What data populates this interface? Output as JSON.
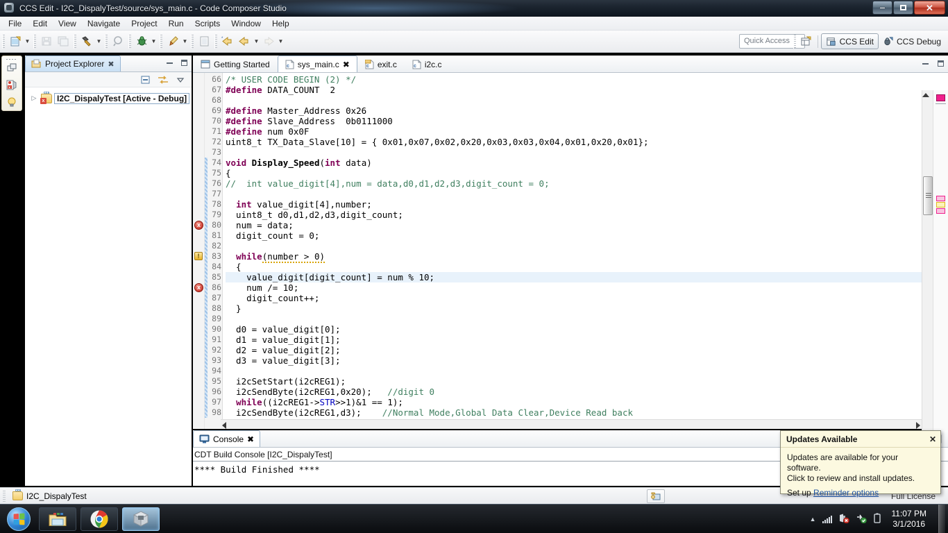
{
  "window": {
    "title": "CCS Edit - I2C_DispalyTest/source/sys_main.c - Code Composer Studio",
    "app_icon": "ccs-logo-icon",
    "minimize_label": "",
    "maximize_label": "",
    "close_label": "✕"
  },
  "menu": {
    "items": [
      {
        "label": "File"
      },
      {
        "label": "Edit"
      },
      {
        "label": "View"
      },
      {
        "label": "Navigate"
      },
      {
        "label": "Project"
      },
      {
        "label": "Run"
      },
      {
        "label": "Scripts"
      },
      {
        "label": "Window"
      },
      {
        "label": "Help"
      }
    ]
  },
  "toolbar": {
    "buttons": [
      {
        "name": "new-file-icon"
      },
      {
        "name": "save-icon"
      },
      {
        "name": "save-all-icon"
      },
      {
        "name": "build-hammer-icon"
      },
      {
        "name": "search-icon"
      },
      {
        "name": "debug-bug-icon"
      },
      {
        "name": "paintbrush-icon"
      },
      {
        "name": "open-declaration-icon"
      },
      {
        "name": "back-history-icon"
      },
      {
        "name": "back-arrow-icon"
      },
      {
        "name": "forward-arrow-icon"
      }
    ],
    "quick_access_placeholder": "Quick Access",
    "open-perspective-icon": "open-perspective-icon",
    "perspectives": [
      {
        "label": "CCS Edit",
        "selected": true,
        "icon": "ccs-edit-icon"
      },
      {
        "label": "CCS Debug",
        "selected": false,
        "icon": "ccs-debug-icon"
      }
    ]
  },
  "project_explorer": {
    "tab_label": "Project Explorer",
    "close_label": "✖",
    "minimize_label": "",
    "maximize_label": "",
    "toolbar_icons": [
      "collapse-all-icon",
      "link-with-editor-icon",
      "view-menu-icon"
    ],
    "tree": [
      {
        "label": "I2C_DispalyTest  [Active - Debug]",
        "twisty": "▷",
        "icon": "ccs-project-icon",
        "selected": true
      }
    ]
  },
  "editor": {
    "tabs": [
      {
        "label": "Getting Started",
        "icon": "getting-started-icon",
        "active": false,
        "closable": false
      },
      {
        "label": "sys_main.c",
        "icon": "c-file-icon",
        "active": true,
        "closable": true,
        "close_label": "✖"
      },
      {
        "label": "exit.c",
        "icon": "c-file-readonly-icon",
        "active": false,
        "closable": false
      },
      {
        "label": "i2c.c",
        "icon": "c-file-icon",
        "active": false,
        "closable": false
      }
    ],
    "minimize_label": "",
    "maximize_label": "",
    "first_line_number": 66,
    "lines": [
      {
        "n": 66,
        "text": "/* USER CODE BEGIN (2) */",
        "type": "comment"
      },
      {
        "n": 67,
        "text": "#define DATA_COUNT  2",
        "type": "preproc"
      },
      {
        "n": 68,
        "text": "",
        "type": "plain"
      },
      {
        "n": 69,
        "text": "#define Master_Address 0x26",
        "type": "preproc"
      },
      {
        "n": 70,
        "text": "#define Slave_Address  0b0111000",
        "type": "preproc"
      },
      {
        "n": 71,
        "text": "#define num 0x0F",
        "type": "preproc"
      },
      {
        "n": 72,
        "text": "uint8_t TX_Data_Slave[10] = { 0x01,0x07,0x02,0x20,0x03,0x03,0x04,0x01,0x20,0x01};",
        "type": "plain"
      },
      {
        "n": 73,
        "text": "",
        "type": "plain"
      },
      {
        "n": 74,
        "text": "void Display_Speed(int data)",
        "type": "funcdef"
      },
      {
        "n": 75,
        "text": "{",
        "type": "plain"
      },
      {
        "n": 76,
        "text": "//  int value_digit[4],num = data,d0,d1,d2,d3,digit_count = 0;",
        "type": "comment"
      },
      {
        "n": 77,
        "text": "",
        "type": "plain"
      },
      {
        "n": 78,
        "text": "  int value_digit[4],number;",
        "type": "decl"
      },
      {
        "n": 79,
        "text": "  uint8_t d0,d1,d2,d3,digit_count;",
        "type": "plain"
      },
      {
        "n": 80,
        "text": "  num = data;",
        "type": "plain",
        "marker": "error"
      },
      {
        "n": 81,
        "text": "  digit_count = 0;",
        "type": "plain"
      },
      {
        "n": 82,
        "text": "",
        "type": "plain"
      },
      {
        "n": 83,
        "text": "  while(number > 0)",
        "type": "while-warn",
        "marker": "warning"
      },
      {
        "n": 84,
        "text": "  {",
        "type": "plain"
      },
      {
        "n": 85,
        "text": "    value_digit[digit_count] = num % 10;",
        "type": "plain",
        "highlight": true
      },
      {
        "n": 86,
        "text": "    num /= 10;",
        "type": "plain",
        "marker": "error"
      },
      {
        "n": 87,
        "text": "    digit_count++;",
        "type": "plain"
      },
      {
        "n": 88,
        "text": "  }",
        "type": "plain"
      },
      {
        "n": 89,
        "text": "",
        "type": "plain"
      },
      {
        "n": 90,
        "text": "  d0 = value_digit[0];",
        "type": "plain"
      },
      {
        "n": 91,
        "text": "  d1 = value_digit[1];",
        "type": "plain"
      },
      {
        "n": 92,
        "text": "  d2 = value_digit[2];",
        "type": "plain"
      },
      {
        "n": 93,
        "text": "  d3 = value_digit[3];",
        "type": "plain"
      },
      {
        "n": 94,
        "text": "",
        "type": "plain"
      },
      {
        "n": 95,
        "text": "  i2cSetStart(i2cREG1);",
        "type": "plain"
      },
      {
        "n": 96,
        "text": "  i2cSendByte(i2cREG1,0x20);   //digit 0",
        "type": "code-comment",
        "code": "  i2cSendByte(i2cREG1,0x20);",
        "comment": "   //digit 0"
      },
      {
        "n": 97,
        "text": "  while((i2cREG1->STR>>1)&1 == 1);",
        "type": "while-str"
      },
      {
        "n": 98,
        "text": "  i2cSendByte(i2cREG1,d3);    //Normal Mode,Global Data Clear,Device Read back",
        "type": "code-comment",
        "code": "  i2cSendByte(i2cREG1,d3);",
        "comment": "    //Normal Mode,Global Data Clear,Device Read back"
      }
    ]
  },
  "console": {
    "tab_label": "Console",
    "tab_icon": "console-icon",
    "close_label": "✖",
    "title": "CDT Build Console [I2C_DispalyTest]",
    "output": "**** Build Finished ****",
    "tools": [
      "scroll-down-icon",
      "scroll-up-icon",
      "scroll-lock-icon",
      "clear-console-icon"
    ]
  },
  "status_bar": {
    "project_label": "I2C_DispalyTest",
    "project_icon": "ccs-project-icon",
    "license_label": "Full License",
    "button_icon": "writable-indicator-icon"
  },
  "updates_popup": {
    "title": "Updates Available",
    "close_label": "✕",
    "line1": "Updates are available for your software.",
    "line2": "Click to review and install updates.",
    "footer_prefix": "Set up ",
    "footer_link": "Reminder options"
  },
  "taskbar": {
    "start_icon": "windows-start-orb-icon",
    "items": [
      {
        "name": "file-explorer-icon",
        "active": false
      },
      {
        "name": "google-chrome-icon",
        "active": false
      },
      {
        "name": "code-composer-studio-icon",
        "active": true
      }
    ],
    "tray": {
      "show_hidden_icons": "▲",
      "icons": [
        "signal-bars-icon",
        "network-error-icon",
        "sync-ok-icon",
        "battery-icon"
      ],
      "time": "11:07 PM",
      "date": "3/1/2016"
    }
  },
  "colors": {
    "accent": "#2a7fd0",
    "keyword": "#7f0055",
    "comment": "#3f7f5f",
    "field": "#0000c0",
    "error": "#c4261a",
    "warning": "#e8b428",
    "highlight_line": "#e8f2fb",
    "popup_bg": "#fcf9e0"
  }
}
